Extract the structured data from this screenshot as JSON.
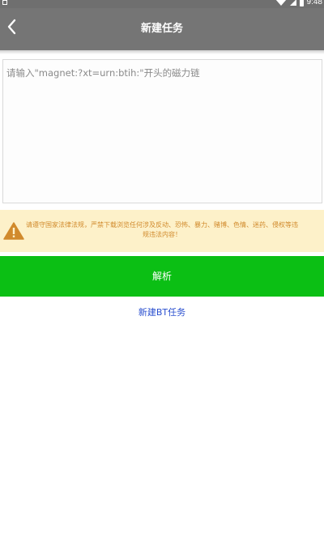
{
  "status_bar": {
    "time": "9:48"
  },
  "header": {
    "title": "新建任务",
    "back_icon": "chevron-left-icon"
  },
  "magnet_input": {
    "placeholder": "请输入\"magnet:?xt=urn:btih:\"开头的磁力链",
    "value": ""
  },
  "warning": {
    "icon": "warning-triangle-icon",
    "text": "请遵守国家法律法规，严禁下载浏览任何涉及反动、恐怖、暴力、赌博、色情、迷药、侵权等违规违法内容！",
    "background": "#fdf1c9",
    "text_color": "#d18a2c"
  },
  "parse_button": {
    "label": "解析",
    "color": "#0bbf14"
  },
  "new_bt_link": {
    "label": "新建BT任务",
    "color": "#2a4fcf"
  }
}
